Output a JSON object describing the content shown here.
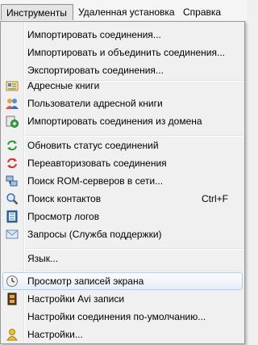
{
  "menubar": {
    "items": [
      {
        "label": "Инструменты"
      },
      {
        "label": "Удаленная установка"
      },
      {
        "label": "Справка"
      }
    ]
  },
  "menu": {
    "items": [
      {
        "label": "Импортировать соединения..."
      },
      {
        "label": "Импортировать и объединить соединения..."
      },
      {
        "label": "Экспортировать соединения..."
      },
      {
        "label": "Адресные книги",
        "icon": "address-book-icon"
      },
      {
        "label": "Пользователи адресной книги",
        "icon": "users-icon"
      },
      {
        "label": "Импортировать соединения из домена",
        "icon": "domain-import-icon"
      },
      {
        "label": "Обновить статус соединений",
        "icon": "refresh-icon"
      },
      {
        "label": "Переавторизовать соединения",
        "icon": "reauthorize-icon"
      },
      {
        "label": "Поиск ROM-серверов в сети...",
        "icon": "network-search-icon"
      },
      {
        "label": "Поиск контактов",
        "shortcut": "Ctrl+F",
        "icon": "magnifier-icon"
      },
      {
        "label": "Просмотр логов",
        "icon": "log-icon"
      },
      {
        "label": "Запросы (Служба поддержки)",
        "icon": "envelope-icon"
      },
      {
        "label": "Язык..."
      },
      {
        "label": "Просмотр записей экрана",
        "icon": "clock-icon",
        "highlighted": true
      },
      {
        "label": "Настройки Avi записи",
        "icon": "film-icon"
      },
      {
        "label": "Настройки соединения по-умолчанию..."
      },
      {
        "label": "Настройки...",
        "icon": "settings-icon"
      }
    ]
  },
  "colors": {
    "highlight_border": "#aeceec",
    "menu_background": "#f0f0f0"
  }
}
